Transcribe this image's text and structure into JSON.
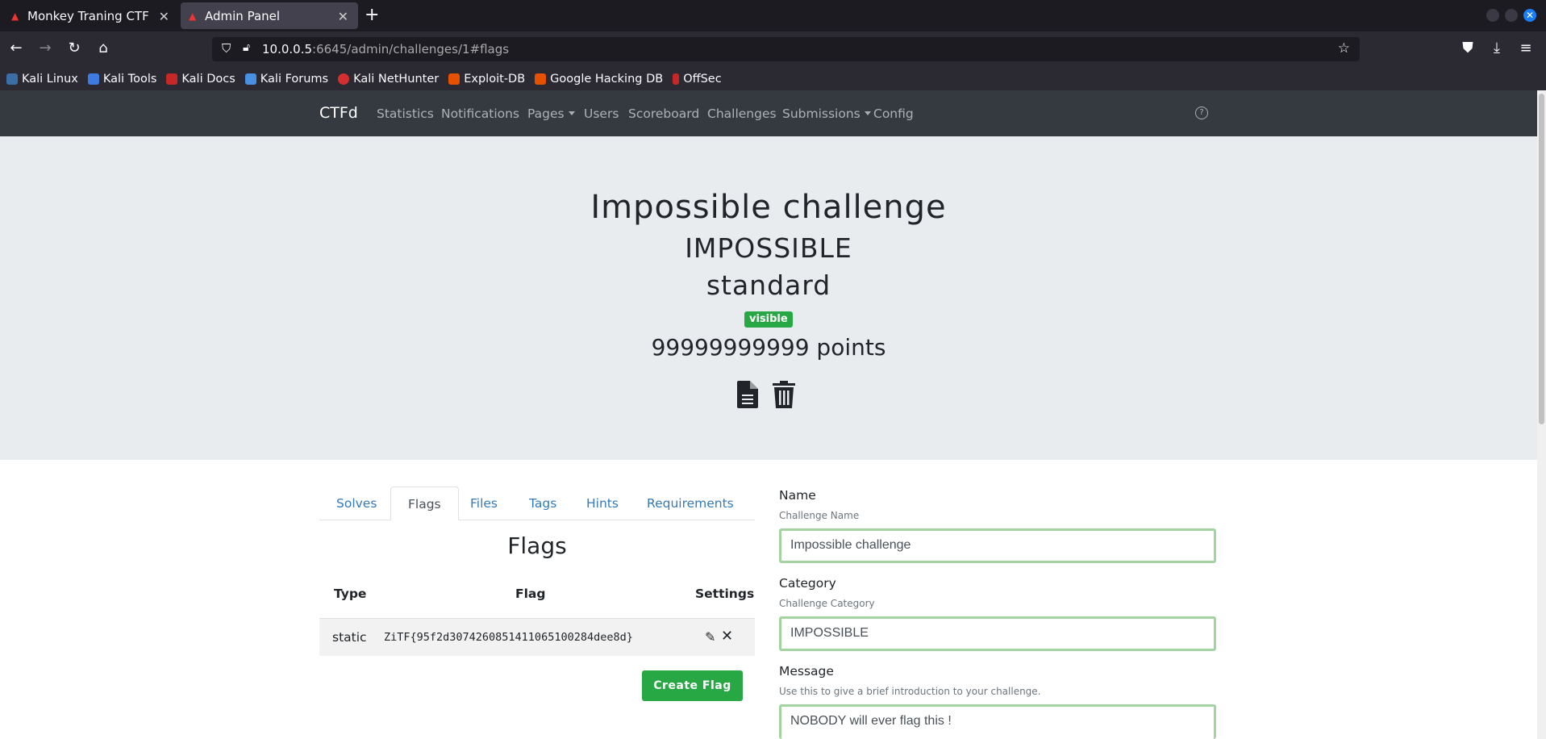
{
  "browser": {
    "tabs": [
      {
        "title": "Monkey Traning CTF",
        "active": false
      },
      {
        "title": "Admin Panel",
        "active": true
      }
    ],
    "url_host": "10.0.0.5",
    "url_rest": ":6645/admin/challenges/1#flags",
    "bookmarks": [
      "Kali Linux",
      "Kali Tools",
      "Kali Docs",
      "Kali Forums",
      "Kali NetHunter",
      "Exploit-DB",
      "Google Hacking DB",
      "OffSec"
    ]
  },
  "ctf_nav": {
    "brand": "CTFd",
    "links": [
      "Statistics",
      "Notifications",
      "Pages",
      "Users",
      "Scoreboard",
      "Challenges",
      "Submissions",
      "Config"
    ]
  },
  "challenge": {
    "name": "Impossible challenge",
    "category": "IMPOSSIBLE",
    "type": "standard",
    "state": "visible",
    "points_text": "99999999999 points"
  },
  "tabs": [
    "Solves",
    "Flags",
    "Files",
    "Tags",
    "Hints",
    "Requirements"
  ],
  "flags_section": {
    "heading": "Flags",
    "columns": [
      "Type",
      "Flag",
      "Settings"
    ],
    "rows": [
      {
        "type": "static",
        "flag": "ZiTF{95f2d307426085141106510028​4dee8d}"
      }
    ],
    "create_button": "Create Flag"
  },
  "form": {
    "name_label": "Name",
    "name_help": "Challenge Name",
    "name_value": "Impossible challenge",
    "category_label": "Category",
    "category_help": "Challenge Category",
    "category_value": "IMPOSSIBLE",
    "message_label": "Message",
    "message_help": "Use this to give a brief introduction to your challenge.",
    "message_value": "NOBODY will ever flag this !"
  },
  "colors": {
    "success": "#28a745",
    "navbar": "#343a40",
    "jumbotron": "#e9ecef",
    "link": "#337ab7"
  }
}
